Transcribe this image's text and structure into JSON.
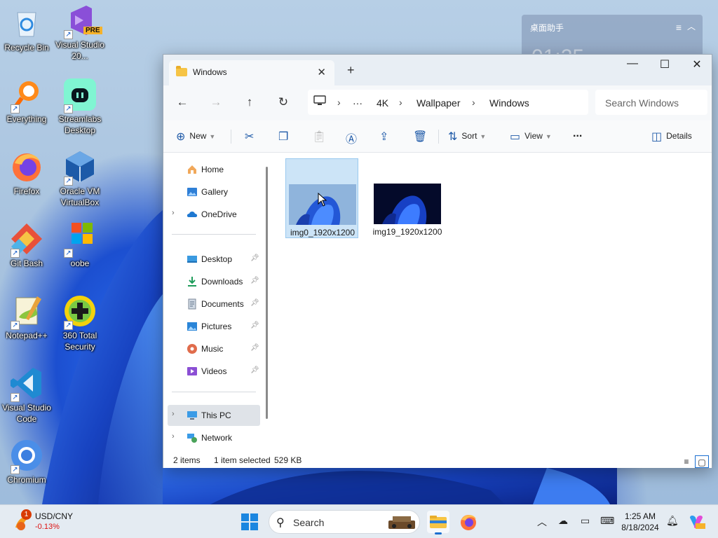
{
  "desktop": {
    "icons": [
      {
        "label": "Recycle Bin"
      },
      {
        "label": "Visual Studio 20...",
        "badge": "PRE"
      },
      {
        "label": "Everything"
      },
      {
        "label": "Streamlabs Desktop"
      },
      {
        "label": "Firefox"
      },
      {
        "label": "Oracle VM VirtualBox"
      },
      {
        "label": "Git Bash"
      },
      {
        "label": "oobe"
      },
      {
        "label": "Notepad++"
      },
      {
        "label": "360 Total Security"
      },
      {
        "label": "Visual Studio Code"
      },
      {
        "label": "Chromium"
      }
    ],
    "widget": {
      "title": "桌面助手",
      "time": "01:25"
    }
  },
  "explorer": {
    "tab_title": "Windows",
    "breadcrumb": [
      "4K",
      "Wallpaper",
      "Windows"
    ],
    "search_placeholder": "Search Windows",
    "commands": {
      "new": "New",
      "sort": "Sort",
      "view": "View",
      "more": "...",
      "details": "Details"
    },
    "nav": {
      "home": "Home",
      "gallery": "Gallery",
      "onedrive": "OneDrive",
      "desktop": "Desktop",
      "downloads": "Downloads",
      "documents": "Documents",
      "pictures": "Pictures",
      "music": "Music",
      "videos": "Videos",
      "thispc": "This PC",
      "network": "Network"
    },
    "files": [
      {
        "name": "img0_1920x1200",
        "selected": true
      },
      {
        "name": "img19_1920x1200",
        "selected": false
      }
    ],
    "status": {
      "count": "2 items",
      "selection": "1 item selected",
      "size": "529 KB"
    }
  },
  "taskbar": {
    "weather_badge": "1",
    "stock_name": "USD/CNY",
    "stock_change": "-0.13%",
    "search_label": "Search",
    "time": "1:25 AM",
    "date": "8/18/2024"
  },
  "colors": {
    "accent": "#1b6fd0",
    "selection": "#cce4f7",
    "negative": "#dd1111"
  }
}
